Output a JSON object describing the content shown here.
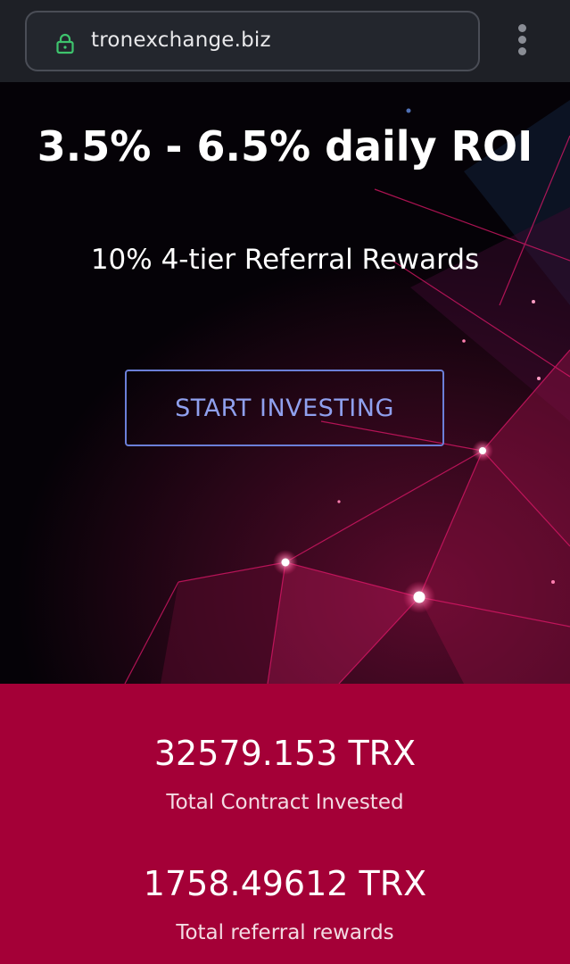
{
  "browser": {
    "url": "tronexchange.biz",
    "lock_icon": "lock-icon",
    "menu_icon": "more-vert-icon"
  },
  "hero": {
    "title": "3.5% - 6.5% daily ROI",
    "subtitle": "10% 4-tier Referral Rewards",
    "cta_label": "START INVESTING"
  },
  "stats": [
    {
      "value": "32579.153 TRX",
      "label": "Total Contract Invested"
    },
    {
      "value": "1758.49612 TRX",
      "label": "Total referral rewards"
    }
  ],
  "colors": {
    "hero_bg": "#050207",
    "accent_magenta": "#e0186a",
    "cta_border": "#6b7fd8",
    "stats_bg": "#a40037"
  }
}
